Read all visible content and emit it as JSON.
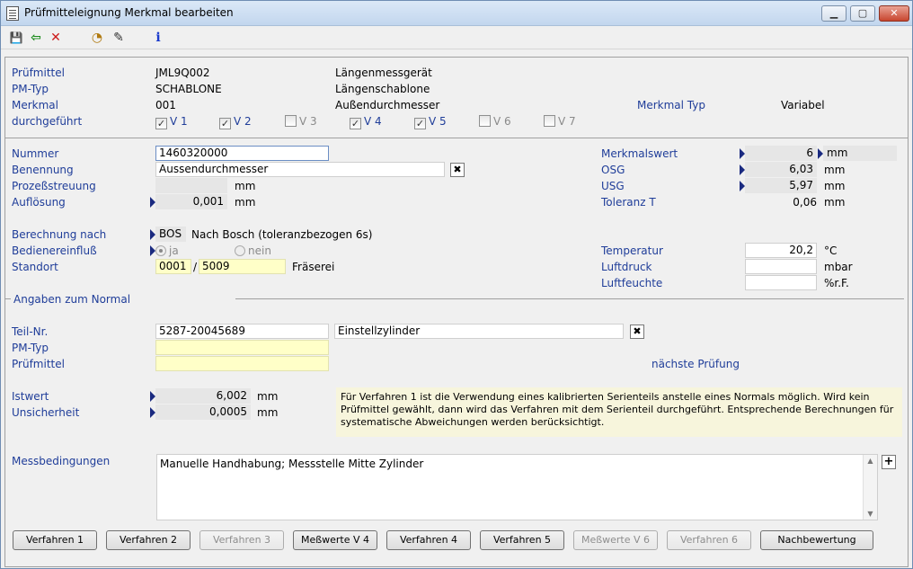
{
  "window": {
    "title": "Prüfmitteleignung Merkmal bearbeiten",
    "min_glyph": "▁",
    "max_glyph": "▢",
    "close_glyph": "✕"
  },
  "toolbar": {
    "save_glyph": "💾",
    "back_glyph": "⇦",
    "cancel_glyph": "✕",
    "calc_glyph": "◔",
    "edit_glyph": "✎",
    "info_glyph": "i"
  },
  "header": {
    "pruefmittel_label": "Prüfmittel",
    "pruefmittel_value": "JML9Q002",
    "pruefmittel_desc": "Längenmessgerät",
    "pmtyp_label": "PM-Typ",
    "pmtyp_value": "SCHABLONE",
    "pmtyp_desc": "Längenschablone",
    "merkmal_label": "Merkmal",
    "merkmal_value": "001",
    "merkmal_desc": "Außendurchmesser",
    "merkmal_typ_label": "Merkmal Typ",
    "merkmal_typ_value": "Variabel",
    "durchgefuehrt_label": "durchgeführt",
    "verfahren": [
      {
        "label": "V 1",
        "checked": true
      },
      {
        "label": "V 2",
        "checked": true
      },
      {
        "label": "V 3",
        "checked": false
      },
      {
        "label": "V 4",
        "checked": true
      },
      {
        "label": "V 5",
        "checked": true
      },
      {
        "label": "V 6",
        "checked": false
      },
      {
        "label": "V 7",
        "checked": false
      }
    ]
  },
  "details": {
    "nummer_label": "Nummer",
    "nummer_value": "1460320000",
    "benennung_label": "Benennung",
    "benennung_value": "Aussendurchmesser",
    "streuung_label": "Prozeßstreuung",
    "streuung_value": "",
    "streuung_unit": "mm",
    "aufloesung_label": "Auflösung",
    "aufloesung_value": "0,001",
    "aufloesung_unit": "mm",
    "merkmalswert_label": "Merkmalswert",
    "merkmalswert_value": "6",
    "merkmalswert_unit": "mm",
    "osg_label": "OSG",
    "osg_value": "6,03",
    "osg_unit": "mm",
    "usg_label": "USG",
    "usg_value": "5,97",
    "usg_unit": "mm",
    "toleranz_label": "Toleranz T",
    "toleranz_value": "0,06",
    "toleranz_unit": "mm",
    "clear_glyph": "✖"
  },
  "calc": {
    "berechnung_label": "Berechnung nach",
    "berechnung_code": "BOS",
    "berechnung_desc": "Nach Bosch (toleranzbezogen 6s)",
    "bediener_label": "Bedienereinfluß",
    "radio_ja": "ja",
    "radio_nein": "nein",
    "standort_label": "Standort",
    "standort_a": "0001",
    "standort_sep": "/",
    "standort_b": "5009",
    "standort_desc": "Fräserei",
    "temperatur_label": "Temperatur",
    "temperatur_value": "20,2",
    "temperatur_unit": "°C",
    "luftdruck_label": "Luftdruck",
    "luftdruck_value": "",
    "luftdruck_unit": "mbar",
    "luftfeuchte_label": "Luftfeuchte",
    "luftfeuchte_value": "",
    "luftfeuchte_unit": "%r.F."
  },
  "normal": {
    "section_title": "Angaben zum Normal",
    "teilnr_label": "Teil-Nr.",
    "teilnr_value": "5287-20045689",
    "teilnr_desc": "Einstellzylinder",
    "pmtyp_label": "PM-Typ",
    "pmtyp_value": "",
    "pruefmittel_label": "Prüfmittel",
    "pruefmittel_value": "",
    "naechste_label": "nächste Prüfung",
    "istwert_label": "Istwert",
    "istwert_value": "6,002",
    "istwert_unit": "mm",
    "unsicherheit_label": "Unsicherheit",
    "unsicherheit_value": "0,0005",
    "unsicherheit_unit": "mm",
    "note": "Für Verfahren 1 ist die Verwendung eines kalibrierten Serienteils anstelle eines Normals möglich. Wird kein Prüfmittel gewählt, dann wird das Verfahren mit dem Serienteil durchgeführt. Entsprechende Berechnungen für systematische Abweichungen werden berücksichtigt.",
    "messbed_label": "Messbedingungen",
    "messbed_value": "Manuelle Handhabung; Messstelle Mitte Zylinder",
    "add_glyph": "+",
    "scroll_up": "▲",
    "scroll_down": "▼"
  },
  "buttons": [
    {
      "label": "Verfahren 1",
      "enabled": true
    },
    {
      "label": "Verfahren 2",
      "enabled": true
    },
    {
      "label": "Verfahren 3",
      "enabled": false
    },
    {
      "label": "Meßwerte V 4",
      "enabled": true
    },
    {
      "label": "Verfahren 4",
      "enabled": true
    },
    {
      "label": "Verfahren 5",
      "enabled": true
    },
    {
      "label": "Meßwerte V 6",
      "enabled": false
    },
    {
      "label": "Verfahren 6",
      "enabled": false
    },
    {
      "label": "Nachbewertung",
      "enabled": true
    }
  ]
}
